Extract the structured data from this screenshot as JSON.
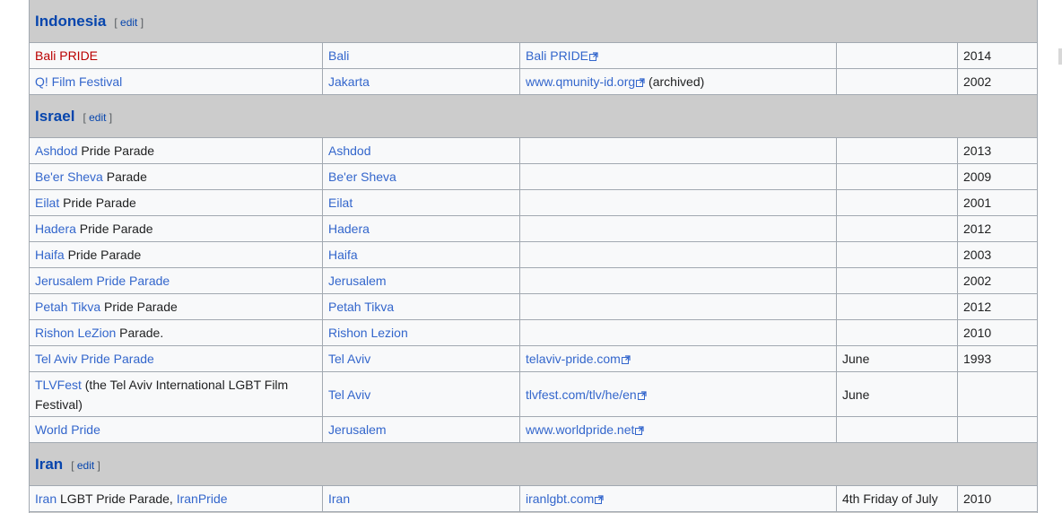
{
  "sections": [
    {
      "country": "Indonesia",
      "edit": "edit",
      "rows": [
        {
          "event": [
            {
              "t": "Bali PRIDE",
              "k": "red"
            }
          ],
          "city": "Bali",
          "site": "Bali PRIDE",
          "site_suffix": "",
          "month": "",
          "year": "2014"
        },
        {
          "event": [
            {
              "t": "Q! Film Festival",
              "k": "link"
            }
          ],
          "city": "Jakarta",
          "site": "www.qmunity-id.org",
          "site_suffix": " (archived)",
          "month": "",
          "year": "2002"
        }
      ]
    },
    {
      "country": "Israel",
      "edit": "edit",
      "rows": [
        {
          "event": [
            {
              "t": "Ashdod",
              "k": "link"
            },
            {
              "t": " Pride Parade",
              "k": "plain"
            }
          ],
          "city": "Ashdod",
          "site": "",
          "site_suffix": "",
          "month": "",
          "year": "2013"
        },
        {
          "event": [
            {
              "t": "Be'er Sheva",
              "k": "link"
            },
            {
              "t": " Parade",
              "k": "plain"
            }
          ],
          "city": "Be'er Sheva",
          "site": "",
          "site_suffix": "",
          "month": "",
          "year": "2009"
        },
        {
          "event": [
            {
              "t": "Eilat",
              "k": "link"
            },
            {
              "t": " Pride Parade",
              "k": "plain"
            }
          ],
          "city": "Eilat",
          "site": "",
          "site_suffix": "",
          "month": "",
          "year": "2001"
        },
        {
          "event": [
            {
              "t": "Hadera",
              "k": "link"
            },
            {
              "t": " Pride Parade",
              "k": "plain"
            }
          ],
          "city": "Hadera",
          "site": "",
          "site_suffix": "",
          "month": "",
          "year": "2012"
        },
        {
          "event": [
            {
              "t": "Haifa",
              "k": "link"
            },
            {
              "t": " Pride Parade",
              "k": "plain"
            }
          ],
          "city": "Haifa",
          "site": "",
          "site_suffix": "",
          "month": "",
          "year": "2003"
        },
        {
          "event": [
            {
              "t": "Jerusalem Pride Parade",
              "k": "link"
            }
          ],
          "city": "Jerusalem",
          "site": "",
          "site_suffix": "",
          "month": "",
          "year": "2002"
        },
        {
          "event": [
            {
              "t": "Petah Tikva",
              "k": "link"
            },
            {
              "t": " Pride Parade",
              "k": "plain"
            }
          ],
          "city": "Petah Tikva",
          "site": "",
          "site_suffix": "",
          "month": "",
          "year": "2012"
        },
        {
          "event": [
            {
              "t": "Rishon LeZion",
              "k": "link"
            },
            {
              "t": " Parade.",
              "k": "plain"
            }
          ],
          "city": "Rishon Lezion",
          "site": "",
          "site_suffix": "",
          "month": "",
          "year": "2010"
        },
        {
          "event": [
            {
              "t": "Tel Aviv Pride Parade",
              "k": "link"
            }
          ],
          "city": "Tel Aviv",
          "site": "telaviv-pride.com",
          "site_suffix": "",
          "month": "June",
          "year": "1993"
        },
        {
          "event": [
            {
              "t": "TLVFest",
              "k": "link"
            },
            {
              "t": " (the Tel Aviv International LGBT Film Festival)",
              "k": "plain"
            }
          ],
          "city": "Tel Aviv",
          "site": "tlvfest.com/tlv/he/en",
          "site_suffix": "",
          "month": "June",
          "year": "",
          "tall": true
        },
        {
          "event": [
            {
              "t": "World Pride",
              "k": "link"
            }
          ],
          "city": "Jerusalem",
          "site": "www.worldpride.net",
          "site_suffix": "",
          "month": "",
          "year": ""
        }
      ]
    },
    {
      "country": "Iran",
      "edit": "edit",
      "rows": [
        {
          "event": [
            {
              "t": "Iran",
              "k": "link"
            },
            {
              "t": " LGBT Pride Parade, ",
              "k": "plain"
            },
            {
              "t": "IranPride",
              "k": "link"
            }
          ],
          "city": "Iran",
          "site": "iranlgbt.com",
          "site_suffix": "",
          "month": "4th Friday of July",
          "year": "2010"
        }
      ]
    },
    {
      "country": "",
      "edit": "",
      "rows": []
    }
  ]
}
